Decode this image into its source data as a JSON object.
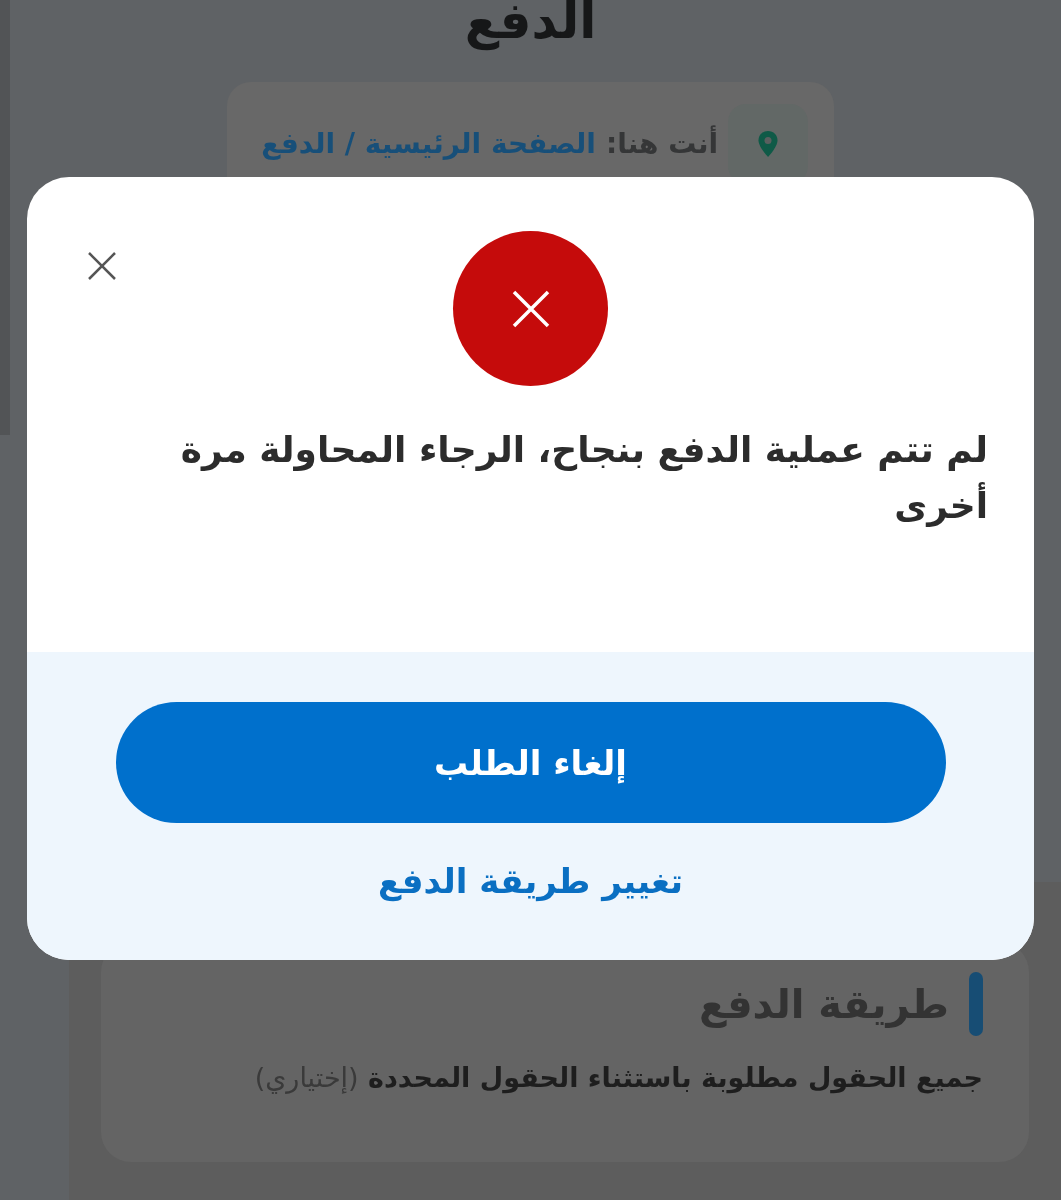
{
  "page": {
    "title": "الدفع",
    "breadcrumb": {
      "label": "أنت هنا:",
      "path": "الصفحة الرئيسية / الدفع"
    },
    "section": {
      "heading": "طريقة الدفع",
      "note": "جميع الحقول مطلوبة باستثناء الحقول المحددة",
      "optional": "(إختياري)"
    }
  },
  "dialog": {
    "error": true,
    "message": "لم تتم عملية الدفع بنجاح، الرجاء المحاولة مرة أخرى",
    "primary_button": "إلغاء الطلب",
    "secondary_link": "تغيير طريقة الدفع"
  }
}
